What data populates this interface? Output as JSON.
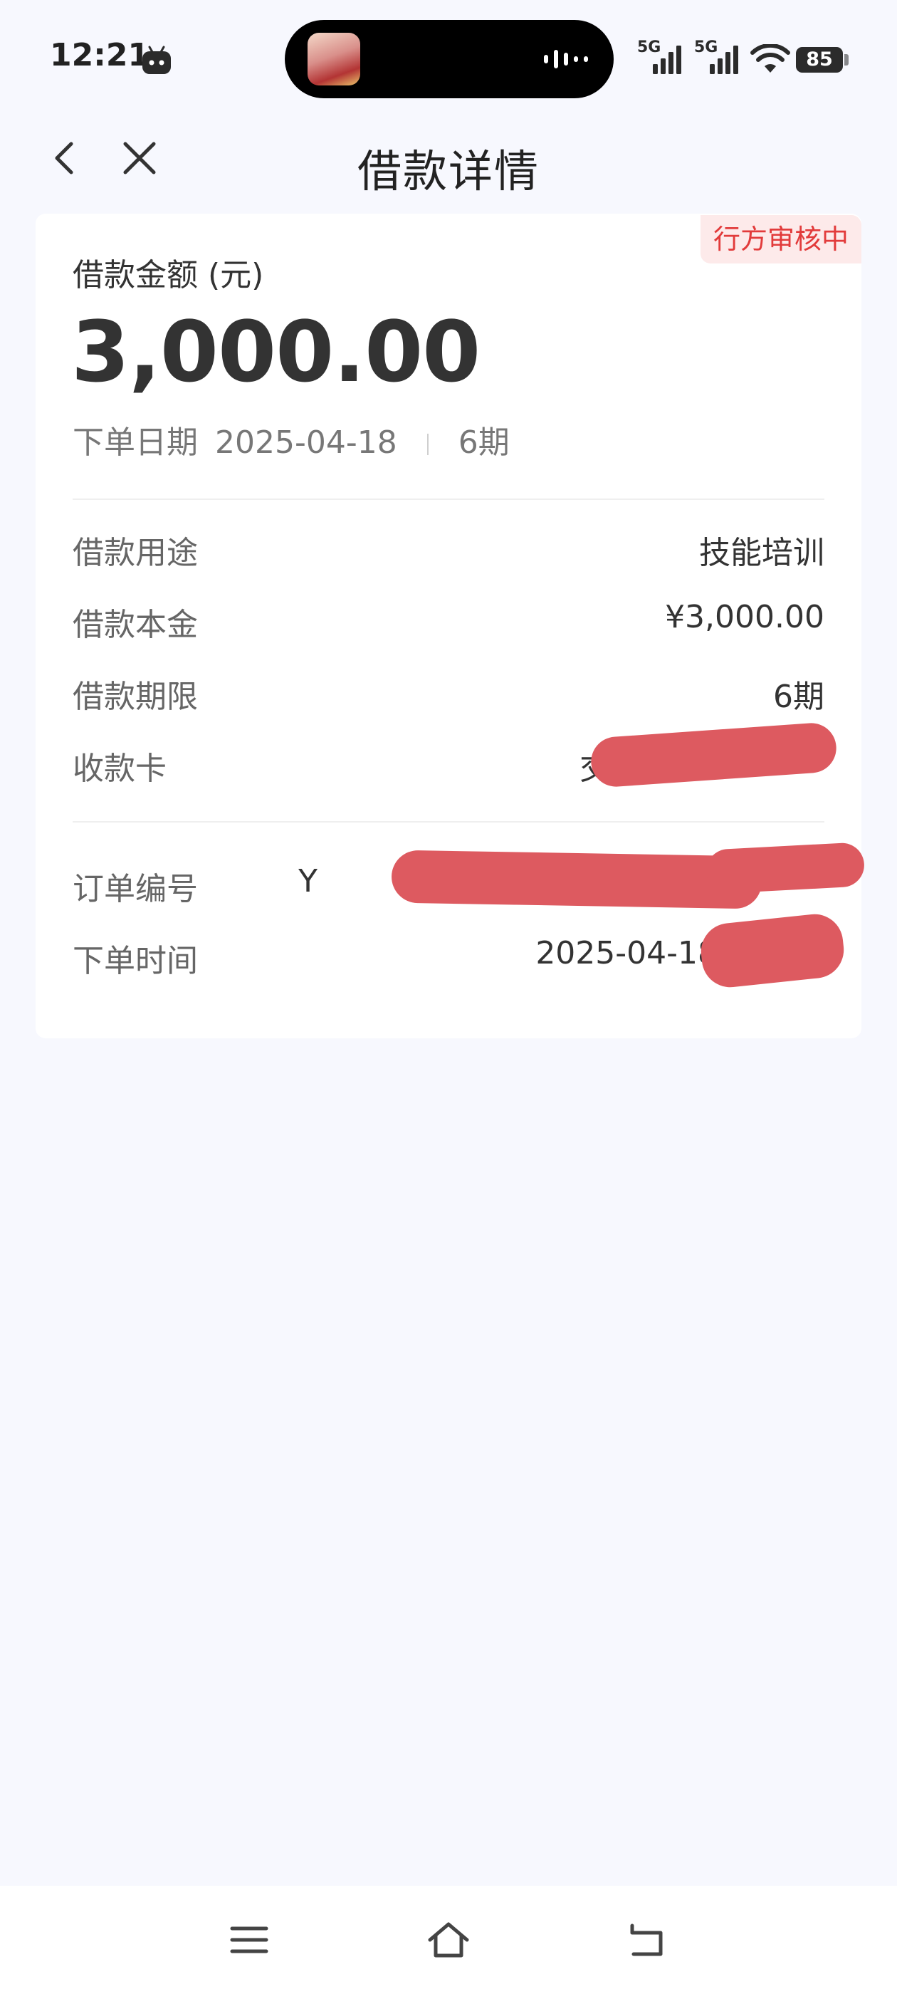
{
  "status_bar": {
    "time": "12:21",
    "signal_1": "5G",
    "signal_2": "5G",
    "battery": "85",
    "icons": [
      "robot-notification-icon",
      "voice-wave-icon",
      "signal-icon",
      "wifi-icon",
      "battery-icon"
    ]
  },
  "nav": {
    "title": "借款详情",
    "back_icon": "chevron-left-icon",
    "close_icon": "close-icon"
  },
  "card": {
    "status_badge": "行方审核中",
    "status_badge_color": "#e23b3b",
    "amount_label": "借款金额 (元)",
    "amount_value": "3,000.00",
    "order_date_label": "下单日期",
    "order_date": "2025-04-18",
    "periods": "6期"
  },
  "details": [
    {
      "label": "借款用途",
      "value": "技能培训"
    },
    {
      "label": "借款本金",
      "value": "¥3,000.00"
    },
    {
      "label": "借款期限",
      "value": "6期"
    },
    {
      "label": "收款卡",
      "value": "交"
    }
  ],
  "order": [
    {
      "label": "订单编号",
      "value": "Y"
    },
    {
      "label": "下单时间",
      "value": "2025-04-18 1"
    }
  ],
  "bottom_nav": {
    "icons": [
      "menu-icon",
      "home-icon",
      "back-icon"
    ]
  }
}
